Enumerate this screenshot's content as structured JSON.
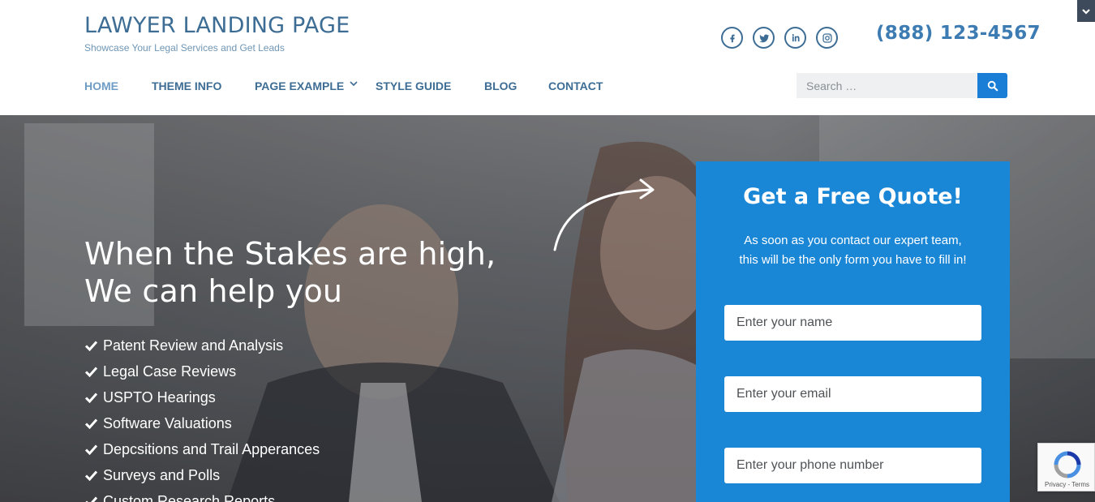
{
  "header": {
    "site_title": "LAWYER LANDING PAGE",
    "tagline": "Showcase Your Legal Services and Get Leads",
    "phone": "(888) 123-4567",
    "social": [
      "facebook-icon",
      "twitter-icon",
      "linkedin-icon",
      "instagram-icon"
    ]
  },
  "nav": {
    "items": [
      {
        "label": "HOME",
        "active": true
      },
      {
        "label": "THEME INFO"
      },
      {
        "label": "PAGE EXAMPLE",
        "has_dropdown": true
      },
      {
        "label": "STYLE GUIDE"
      },
      {
        "label": "BLOG"
      },
      {
        "label": "CONTACT"
      }
    ]
  },
  "search": {
    "placeholder": "Search …"
  },
  "hero": {
    "headline_line1": "When the Stakes are high,",
    "headline_line2": "We can help you",
    "services": [
      "Patent Review and Analysis",
      "Legal Case Reviews",
      "USPTO Hearings",
      "Software Valuations",
      "Depcsitions and Trail Apperances",
      "Surveys and Polls",
      "Custom Research Reports"
    ]
  },
  "quote_form": {
    "title": "Get a Free Quote!",
    "subtitle_line1": "As soon as you contact our expert team,",
    "subtitle_line2": "this will be the only form you have to fill in!",
    "name_placeholder": "Enter your name",
    "email_placeholder": "Enter your email",
    "phone_placeholder": "Enter your phone number"
  },
  "recaptcha": {
    "footer": "Privacy - Terms"
  },
  "colors": {
    "brand": "#3d6d94",
    "accent": "#1a86d6",
    "search_button": "#1a7ed6"
  }
}
